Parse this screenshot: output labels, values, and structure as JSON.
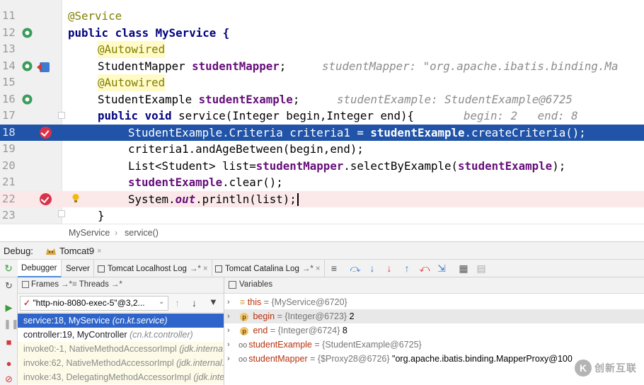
{
  "editor": {
    "lines": [
      {
        "num": "11",
        "code": "@Service"
      },
      {
        "num": "12",
        "code": "public class MyService {"
      },
      {
        "num": "13",
        "code": "@Autowired"
      },
      {
        "num": "14",
        "code": "StudentMapper studentMapper;",
        "hint": "studentMapper: \"org.apache.ibatis.binding.Ma"
      },
      {
        "num": "15",
        "code": "@Autowired"
      },
      {
        "num": "16",
        "code": "StudentExample studentExample;",
        "hint": "studentExample: StudentExample@6725"
      },
      {
        "num": "17",
        "code": "public void service(Integer begin,Integer end){",
        "hint": "begin: 2   end: 8"
      },
      {
        "num": "18",
        "code": "StudentExample.Criteria criteria1 = studentExample.createCriteria();"
      },
      {
        "num": "19",
        "code": "criteria1.andAgeBetween(begin,end);"
      },
      {
        "num": "20",
        "code": "List<Student> list=studentMapper.selectByExample(studentExample);"
      },
      {
        "num": "21",
        "code": "studentExample.clear();"
      },
      {
        "num": "22",
        "code": "System.out.println(list);"
      },
      {
        "num": "23",
        "code": "}"
      }
    ]
  },
  "breadcrumb": {
    "class_name": "MyService",
    "method_name": "service()"
  },
  "debug": {
    "label": "Debug:",
    "config": "Tomcat9"
  },
  "toolbar": {
    "tabs": [
      "Debugger",
      "Server",
      "Tomcat Localhost Log",
      "Tomcat Catalina Log"
    ],
    "tab_suffix": "→*"
  },
  "frames": {
    "frames_tab": "Frames",
    "threads_tab": "Threads",
    "thread_selected": "\"http-nio-8080-exec-5\"@3,2...",
    "items": [
      {
        "method": "service:18, MyService",
        "pkg": "(cn.kt.service)"
      },
      {
        "method": "controller:19, MyController",
        "pkg": "(cn.kt.controller)"
      },
      {
        "method": "invoke0:-1, NativeMethodAccessorImpl",
        "pkg": "(jdk.interna"
      },
      {
        "method": "invoke:62, NativeMethodAccessorImpl",
        "pkg": "(jdk.internal."
      },
      {
        "method": "invoke:43, DelegatingMethodAccessorImpl",
        "pkg": "(jdk.inte"
      }
    ]
  },
  "variables": {
    "title": "Variables",
    "items": [
      {
        "name": "this",
        "value": "{MyService@6720}"
      },
      {
        "name": "begin",
        "value": "{Integer@6723}",
        "num": "2"
      },
      {
        "name": "end",
        "value": "{Integer@6724}",
        "num": "8"
      },
      {
        "name": "studentExample",
        "value": "{StudentExample@6725}"
      },
      {
        "name": "studentMapper",
        "value": "{$Proxy28@6726}",
        "num": "\"org.apache.ibatis.binding.MapperProxy@100"
      }
    ]
  },
  "watermark": {
    "text": "创新互联",
    "logo": "K"
  }
}
